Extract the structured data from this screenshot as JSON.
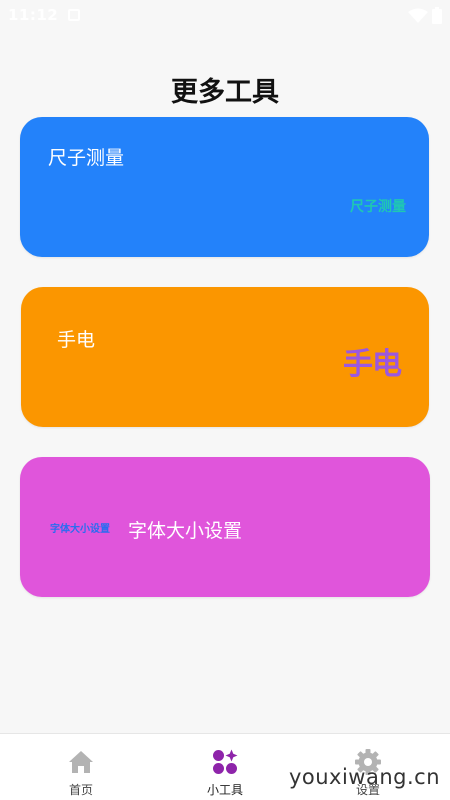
{
  "status_bar": {
    "time": "11:12",
    "icons": [
      "notification-icon",
      "wifi-icon",
      "battery-icon"
    ]
  },
  "page": {
    "title": "更多工具"
  },
  "cards": [
    {
      "id": "ruler",
      "title": "尺子测量",
      "decor_text": "尺子测量",
      "color": "#2382fa",
      "decor_color": "#1fc7b3"
    },
    {
      "id": "torch",
      "title": "手电",
      "decor_text": "手电",
      "color": "#fb9600",
      "decor_color": "#9b58e0"
    },
    {
      "id": "font",
      "title": "字体大小设置",
      "decor_text": "字体大小设置",
      "color": "#e055db",
      "decor_color": "#2a6cf0"
    }
  ],
  "bottom_nav": {
    "items": [
      {
        "label": "首页",
        "icon": "home-icon",
        "active": false
      },
      {
        "label": "小工具",
        "icon": "tools-icon",
        "active": true
      },
      {
        "label": "设置",
        "icon": "gear-icon",
        "active": false
      }
    ],
    "active_color": "#8e24aa",
    "inactive_color": "#b3b3b3"
  },
  "watermark": "youxiwang.cn"
}
